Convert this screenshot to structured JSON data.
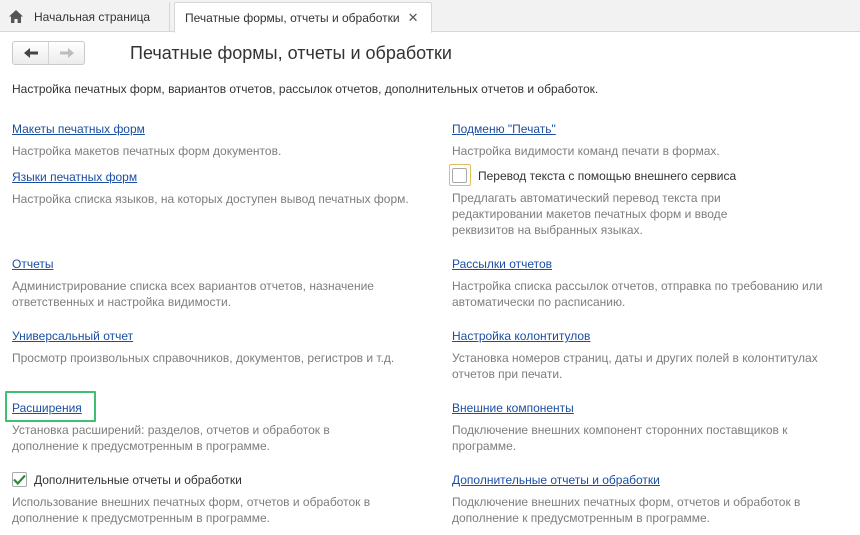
{
  "tabs": {
    "home": "Начальная страница",
    "active": "Печатные формы, отчеты и обработки",
    "close": "✕"
  },
  "page": {
    "title": "Печатные формы, отчеты и обработки",
    "intro": "Настройка печатных форм, вариантов отчетов, рассылок отчетов, дополнительных отчетов и обработок."
  },
  "left": {
    "print_layouts": {
      "link": "Макеты печатных форм",
      "desc": "Настройка макетов печатных форм документов."
    },
    "print_languages": {
      "link": "Языки печатных форм",
      "desc": "Настройка списка языков, на которых доступен вывод печатных форм."
    },
    "reports": {
      "link": "Отчеты",
      "desc": "Администрирование списка всех вариантов отчетов, назначение ответственных и настройка видимости."
    },
    "universal_report": {
      "link": "Универсальный отчет",
      "desc": "Просмотр произвольных справочников, документов, регистров и т.д."
    },
    "extensions": {
      "link": "Расширения",
      "desc": "Установка расширений: разделов, отчетов и обработок в дополнение к предусмотренным в программе."
    },
    "additional": {
      "label": "Дополнительные отчеты и обработки",
      "checked": true,
      "desc": "Использование внешних печатных форм, отчетов и обработок в дополнение к предусмотренным в программе."
    }
  },
  "right": {
    "print_submenu": {
      "link": "Подменю \"Печать\"",
      "desc": "Настройка видимости команд печати в формах."
    },
    "translation": {
      "label": "Перевод текста с помощью внешнего сервиса",
      "checked": false,
      "desc": "Предлагать автоматический перевод текста при редактировании макетов печатных форм и вводе реквизитов на выбранных языках."
    },
    "mailings": {
      "link": "Рассылки отчетов",
      "desc": "Настройка списка рассылок отчетов, отправка по требованию или автоматически по расписанию."
    },
    "headers": {
      "link": "Настройка колонтитулов",
      "desc": "Установка номеров страниц, даты и других полей в колонтитулах отчетов при печати."
    },
    "external_components": {
      "link": "Внешние компоненты",
      "desc": "Подключение внешних компонент сторонних поставщиков к программе."
    },
    "additional": {
      "link": "Дополнительные отчеты и обработки",
      "desc": "Подключение внешних печатных форм, отчетов и обработок в дополнение к предусмотренным в программе."
    }
  },
  "colors": {
    "link": "#1b4ea3",
    "description": "#7d7d7d",
    "focus_green": "#3fbf72",
    "check_green": "#2e8b3a"
  }
}
